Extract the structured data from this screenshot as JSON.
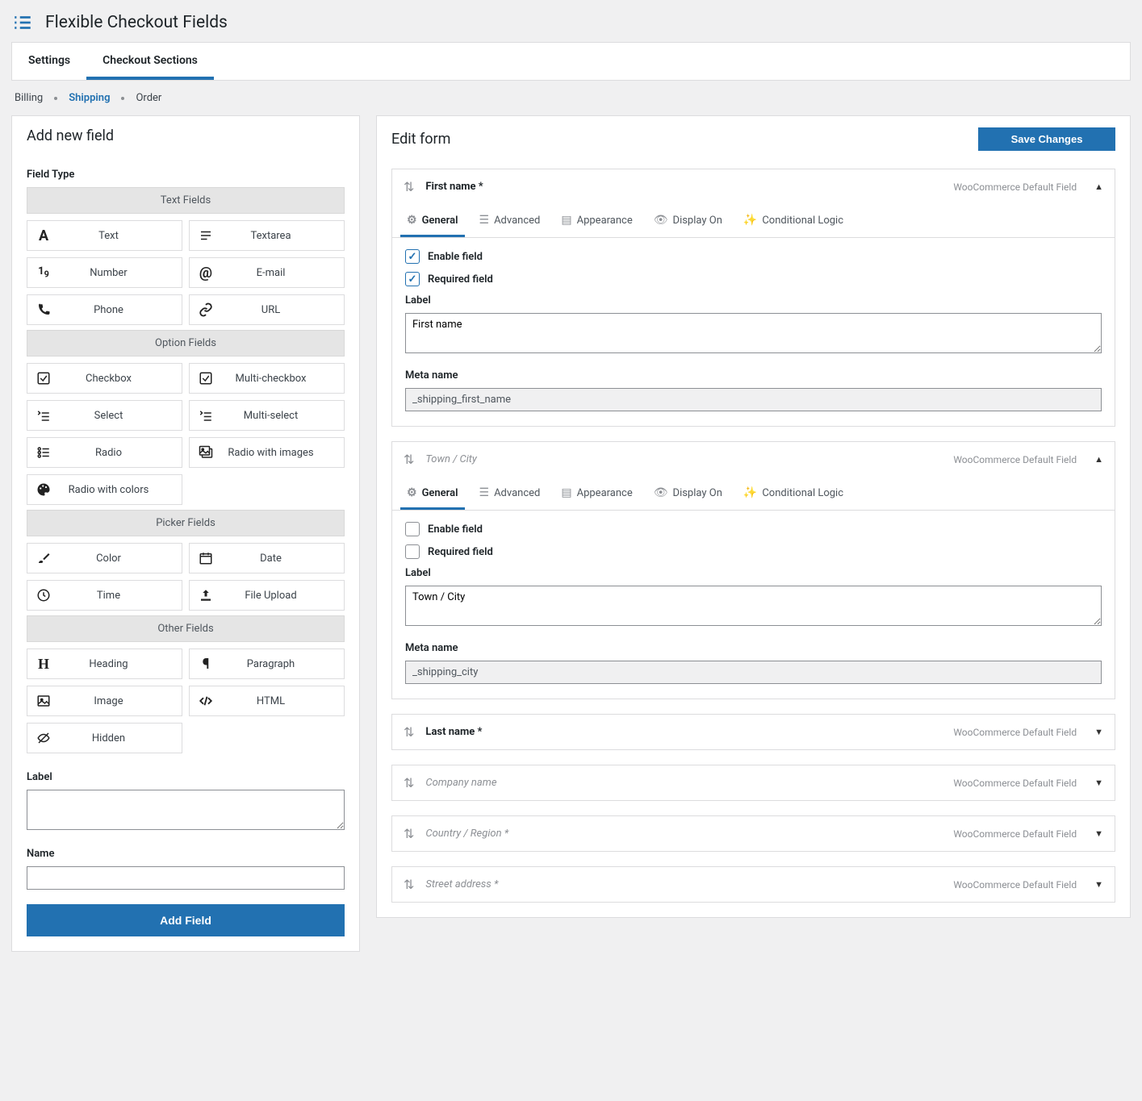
{
  "header": {
    "title": "Flexible Checkout Fields"
  },
  "tabs": {
    "settings": "Settings",
    "sections": "Checkout Sections"
  },
  "breadcrumb": {
    "billing": "Billing",
    "shipping": "Shipping",
    "order": "Order"
  },
  "left_panel": {
    "title": "Add new field",
    "field_type_label": "Field Type",
    "label_label": "Label",
    "name_label": "Name",
    "add_button": "Add Field",
    "groups": {
      "text": "Text Fields",
      "option": "Option Fields",
      "picker": "Picker Fields",
      "other": "Other Fields"
    },
    "types": {
      "text": "Text",
      "textarea": "Textarea",
      "number": "Number",
      "email": "E-mail",
      "phone": "Phone",
      "url": "URL",
      "checkbox": "Checkbox",
      "multi_checkbox": "Multi-checkbox",
      "select": "Select",
      "multi_select": "Multi-select",
      "radio": "Radio",
      "radio_images": "Radio with images",
      "radio_colors": "Radio with colors",
      "color": "Color",
      "date": "Date",
      "time": "Time",
      "file": "File Upload",
      "heading": "Heading",
      "paragraph": "Paragraph",
      "image": "Image",
      "html": "HTML",
      "hidden": "Hidden"
    }
  },
  "right_panel": {
    "title": "Edit form",
    "save_button": "Save Changes",
    "badge": "WooCommerce Default Field",
    "tab_labels": {
      "general": "General",
      "advanced": "Advanced",
      "appearance": "Appearance",
      "display": "Display On",
      "conditional": "Conditional Logic"
    },
    "form_labels": {
      "enable": "Enable field",
      "required": "Required field",
      "label": "Label",
      "meta": "Meta name"
    },
    "fields": [
      {
        "title": "First name *",
        "disabled": false,
        "expanded": true,
        "enable": true,
        "required": true,
        "label_value": "First name",
        "meta_value": "_shipping_first_name"
      },
      {
        "title": "Town / City",
        "disabled": true,
        "expanded": true,
        "enable": false,
        "required": false,
        "label_value": "Town / City",
        "meta_value": "_shipping_city"
      },
      {
        "title": "Last name *",
        "disabled": false,
        "expanded": false
      },
      {
        "title": "Company name",
        "disabled": true,
        "expanded": false
      },
      {
        "title": "Country / Region *",
        "disabled": true,
        "expanded": false
      },
      {
        "title": "Street address *",
        "disabled": true,
        "expanded": false
      }
    ]
  }
}
